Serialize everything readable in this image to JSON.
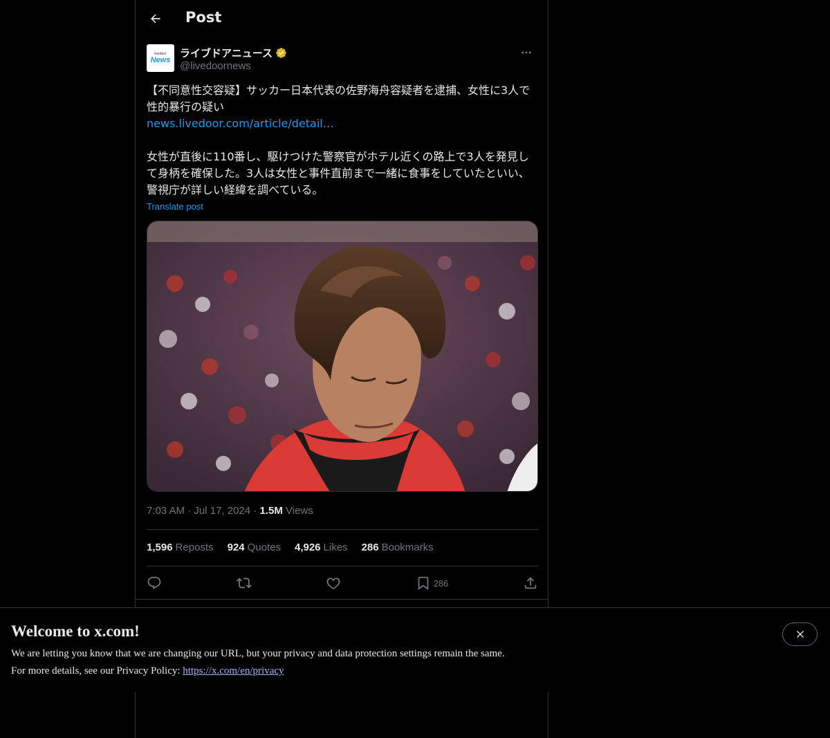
{
  "header": {
    "title": "Post"
  },
  "author": {
    "avatar_top": "livedoor",
    "avatar_bottom": "News",
    "display_name": "ライブドアニュース",
    "handle": "@livedoornews"
  },
  "post": {
    "text_1": "【不同意性交容疑】サッカー日本代表の佐野海舟容疑者を逮捕、女性に3人で性的暴行の疑い",
    "link": "news.livedoor.com/article/detail…",
    "text_2": "女性が直後に110番し、駆けつけた警察官がホテル近くの路上で3人を発見して身柄を確保した。3人は女性と事件直前まで一緒に食事をしていたといい、警視庁が詳しい経緯を調べている。",
    "translate_label": "Translate post"
  },
  "meta": {
    "time": "7:03 AM",
    "separator": "·",
    "date": "Jul 17, 2024",
    "views_count": "1.5M",
    "views_label": "Views"
  },
  "stats": {
    "reposts_count": "1,596",
    "reposts_label": "Reposts",
    "quotes_count": "924",
    "quotes_label": "Quotes",
    "likes_count": "4,926",
    "likes_label": "Likes",
    "bookmarks_count": "286",
    "bookmarks_label": "Bookmarks"
  },
  "actions": {
    "bookmark_count": "286"
  },
  "banner": {
    "title": "Welcome to x.com!",
    "line1": "We are letting you know that we are changing our URL, but your privacy and data protection settings remain the same.",
    "line2_prefix": "For more details, see our Privacy Policy: ",
    "link": "https://x.com/en/privacy"
  },
  "colors": {
    "background": "#000000",
    "text": "#e7e9ea",
    "muted": "#71767b",
    "accent": "#1d9bf0",
    "border": "#2f3336",
    "verified": "#e2b719"
  },
  "icons": [
    "back-arrow-icon",
    "verified-badge-icon",
    "more-icon",
    "reply-icon",
    "repost-icon",
    "like-icon",
    "bookmark-icon",
    "share-icon",
    "close-icon"
  ]
}
